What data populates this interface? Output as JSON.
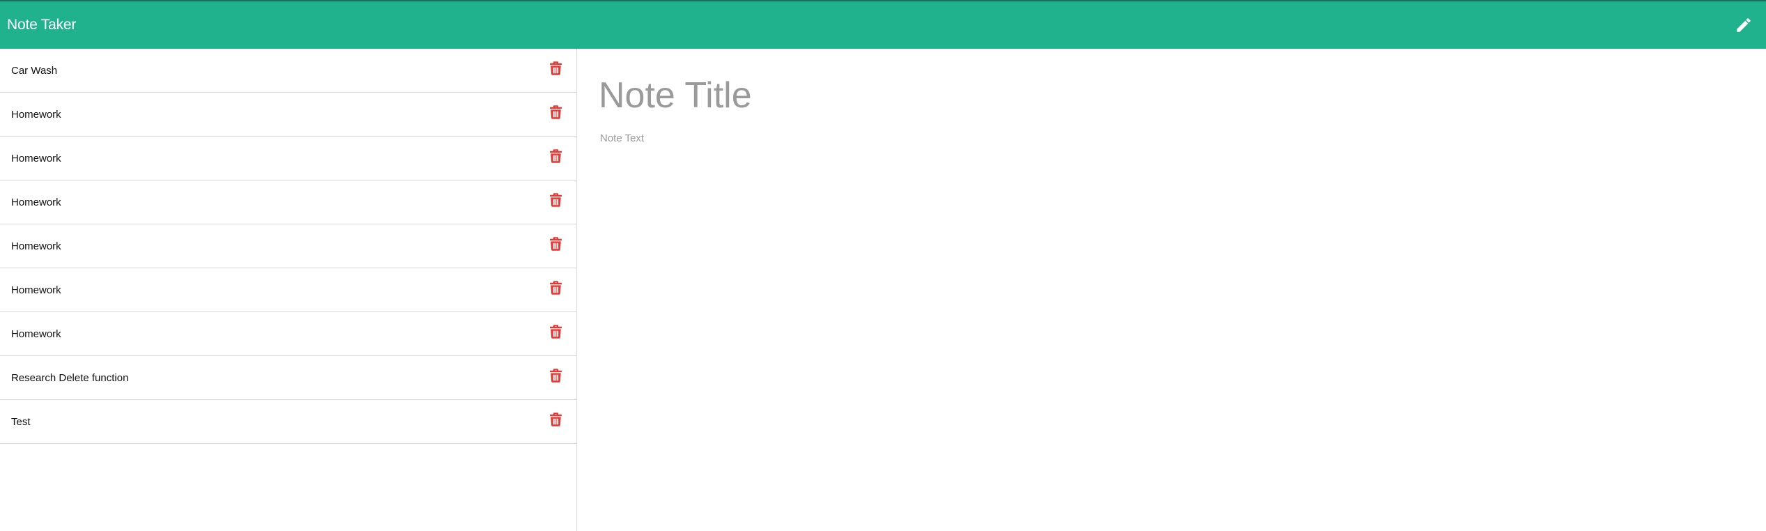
{
  "app": {
    "brand": "Note Taker",
    "accent_color": "#20b28c",
    "new_note_icon": "pencil-icon"
  },
  "notes": [
    {
      "title": "Car Wash"
    },
    {
      "title": "Homework"
    },
    {
      "title": "Homework"
    },
    {
      "title": "Homework"
    },
    {
      "title": "Homework"
    },
    {
      "title": "Homework"
    },
    {
      "title": "Homework"
    },
    {
      "title": "Research Delete function"
    },
    {
      "title": "Test"
    }
  ],
  "delete_icon": {
    "name": "trash-icon",
    "color": "#e53935"
  },
  "editor": {
    "title_placeholder": "Note Title",
    "title_value": "",
    "text_placeholder": "Note Text",
    "text_value": ""
  }
}
